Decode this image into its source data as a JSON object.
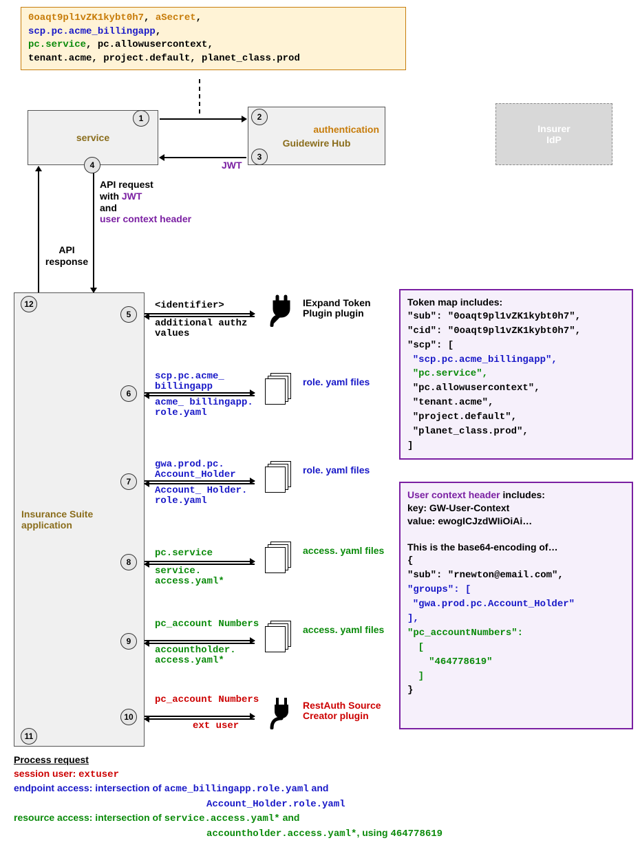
{
  "topbox": {
    "l1a": "0oaqt9pl1vZK1kybt0h7",
    "l1b": "aSecret",
    "l2": "scp.pc.acme_billingapp",
    "l3a": "pc.service",
    "l3b": "pc.allowusercontext",
    "l4": "tenant.acme, project.default, planet_class.prod"
  },
  "boxes": {
    "service": "service",
    "hub_auth": "authentication",
    "hub": "Guidewire Hub",
    "idp1": "Insurer",
    "idp2": "IdP",
    "app": "Insurance Suite application"
  },
  "steps": {
    "s1": "1",
    "s2": "2",
    "s3": "3",
    "s4": "4",
    "s5": "5",
    "s6": "6",
    "s7": "7",
    "s8": "8",
    "s9": "9",
    "s10": "10",
    "s11": "11",
    "s12": "12"
  },
  "labels": {
    "jwt": "JWT",
    "apiresp": "API response",
    "apireq1": "API request",
    "apireq2": "with ",
    "apireq2b": "JWT",
    "apireq3": "and",
    "apireq4": "user context header"
  },
  "row5": {
    "top": "<identifier>",
    "bot": "additional authz values",
    "right": "IExpand Token Plugin plugin"
  },
  "row6": {
    "top": "scp.pc.acme_ billingapp",
    "bot": "acme_ billingapp. role.yaml",
    "right": "role. yaml files"
  },
  "row7": {
    "top": "gwa.prod.pc. Account_Holder",
    "bot": "Account_ Holder. role.yaml",
    "right": "role. yaml files"
  },
  "row8": {
    "top": "pc.service",
    "bot": "service. access.yaml*",
    "right": "access. yaml files"
  },
  "row9": {
    "top": "pc_account Numbers",
    "bot": "accountholder. access.yaml*",
    "right": "access. yaml files"
  },
  "row10": {
    "top": "pc_account Numbers",
    "bot": "ext user",
    "right": "RestAuth Source Creator plugin"
  },
  "token": {
    "title": "Token map",
    "includes": " includes:",
    "sub": "\"sub\": \"0oaqt9pl1vZK1kybt0h7\",",
    "cid": "\"cid\": \"0oaqt9pl1vZK1kybt0h7\",",
    "scp": "\"scp\": [",
    "i1": "\"scp.pc.acme_billingapp\",",
    "i2": "\"pc.service\",",
    "i3": "\"pc.allowusercontext\",",
    "i4": "\"tenant.acme\",",
    "i5": "\"project.default\",",
    "i6": "\"planet_class.prod\",",
    "close": "]"
  },
  "user": {
    "title": "User context header",
    "includes": " includes:",
    "key": "key: GW-User-Context",
    "val": "value: ewogICJzdWIiOiAi…",
    "desc": "This is the base64-encoding of…",
    "open": "{",
    "sub": "\"sub\": \"rnewton@email.com\",",
    "grp": "\"groups\": [",
    "grp1": "\"gwa.prod.pc.Account_Holder\"",
    "grpclose": "],",
    "pcacct": "\"pc_accountNumbers\":",
    "bo": "[",
    "num": "\"464778619\"",
    "bc": "]",
    "close": "}"
  },
  "summary": {
    "title": "Process request",
    "l1a": "session user: ",
    "l1b": "extuser",
    "l2a": "endpoint access: intersection of ",
    "l2b": "acme_billingapp.role.yaml",
    "l2c": "  and",
    "l2d": "Account_Holder.role.yaml",
    "l3a": "resource access: intersection of ",
    "l3b": "service.access.yaml*",
    "l3c": "  and",
    "l3d": "accountholder.access.yaml*",
    "l3e": ", using ",
    "l3f": "464778619"
  }
}
